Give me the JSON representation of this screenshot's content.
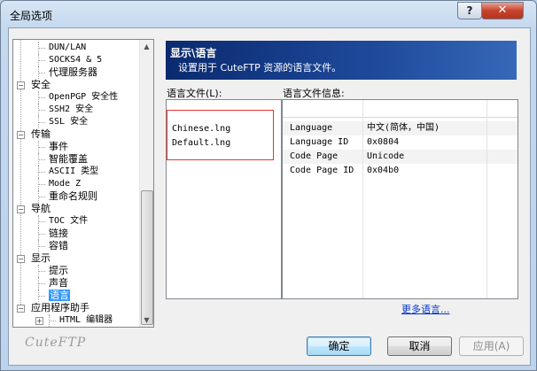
{
  "window": {
    "title": "全局选项",
    "help_glyph": "?",
    "close_glyph": "✕"
  },
  "tree": {
    "items": [
      {
        "label": "DUN/LAN",
        "level": 2,
        "mono": true
      },
      {
        "label": "SOCKS4 & 5",
        "level": 2,
        "mono": true
      },
      {
        "label": "代理服务器",
        "level": 2
      },
      {
        "label": "安全",
        "level": 1,
        "expander": "−"
      },
      {
        "label": "OpenPGP 安全性",
        "level": 2,
        "mono": true
      },
      {
        "label": "SSH2 安全",
        "level": 2,
        "mono": true
      },
      {
        "label": "SSL 安全",
        "level": 2,
        "mono": true
      },
      {
        "label": "传输",
        "level": 1,
        "expander": "−"
      },
      {
        "label": "事件",
        "level": 2
      },
      {
        "label": "智能覆盖",
        "level": 2
      },
      {
        "label": "ASCII 类型",
        "level": 2,
        "mono": true
      },
      {
        "label": "Mode Z",
        "level": 2,
        "mono": true
      },
      {
        "label": "重命名规则",
        "level": 2
      },
      {
        "label": "导航",
        "level": 1,
        "expander": "−"
      },
      {
        "label": "TOC 文件",
        "level": 2,
        "mono": true
      },
      {
        "label": "链接",
        "level": 2
      },
      {
        "label": "容错",
        "level": 2
      },
      {
        "label": "显示",
        "level": 1,
        "expander": "−"
      },
      {
        "label": "提示",
        "level": 2
      },
      {
        "label": "声音",
        "level": 2
      },
      {
        "label": "语言",
        "level": 2,
        "selected": true
      },
      {
        "label": "应用程序助手",
        "level": 1,
        "expander": "−"
      },
      {
        "label": "HTML 编辑器",
        "level": 3,
        "mono": true,
        "expander": "+"
      }
    ]
  },
  "watermark": "CuteFTP",
  "panel": {
    "title": "显示\\语言",
    "description": "设置用于 CuteFTP 资源的语言文件。"
  },
  "language_files": {
    "label": "语言文件(L):",
    "items": [
      "Chinese.lng",
      "Default.lng"
    ]
  },
  "language_info": {
    "label": "语言文件信息:",
    "rows": [
      {
        "key": "Language",
        "value": "中文(简体，中国)"
      },
      {
        "key": "Language ID",
        "value": "0x0804"
      },
      {
        "key": "Code Page",
        "value": "Unicode"
      },
      {
        "key": "Code Page ID",
        "value": "0x04b0"
      }
    ]
  },
  "more_languages": "更多语言...",
  "buttons": {
    "ok": "确定",
    "cancel": "取消",
    "apply": "应用(A)"
  }
}
